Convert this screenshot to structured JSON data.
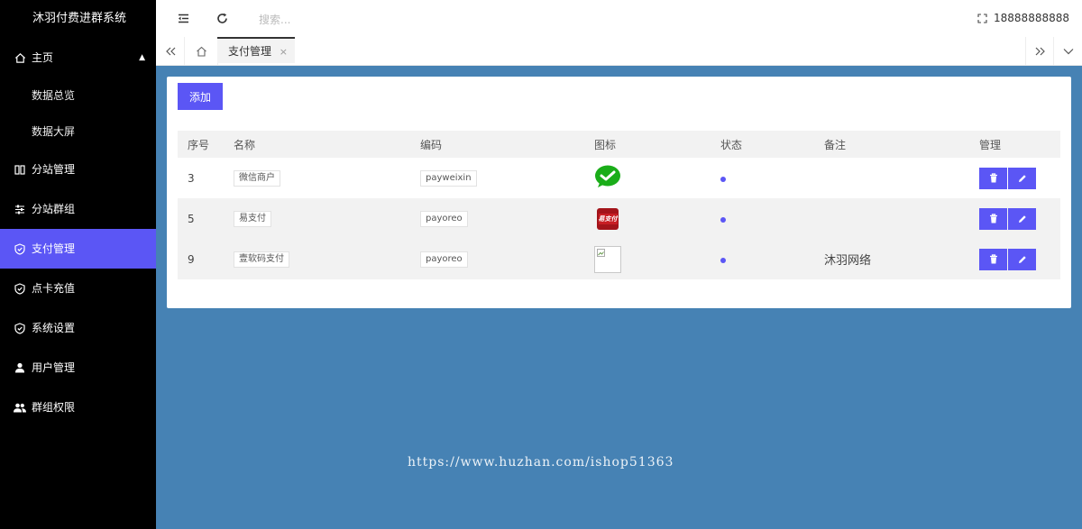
{
  "app": {
    "title": "沐羽付费进群系统"
  },
  "sidebar": {
    "home": {
      "label": "主页",
      "icon": "home-icon"
    },
    "home_children": [
      {
        "label": "数据总览"
      },
      {
        "label": "数据大屏"
      }
    ],
    "items": [
      {
        "label": "分站管理",
        "icon": "columns-icon"
      },
      {
        "label": "分站群组",
        "icon": "sliders-icon"
      },
      {
        "label": "支付管理",
        "icon": "shield-icon",
        "active": true
      },
      {
        "label": "点卡充值",
        "icon": "shield-icon"
      },
      {
        "label": "系统设置",
        "icon": "shield-icon"
      },
      {
        "label": "用户管理",
        "icon": "user-icon"
      },
      {
        "label": "群组权限",
        "icon": "users-icon"
      }
    ]
  },
  "topbar": {
    "search_placeholder": "搜索...",
    "user_name": "18888888888"
  },
  "tabs": {
    "active_label": "支付管理",
    "close_glyph": "×"
  },
  "toolbar": {
    "add_label": "添加"
  },
  "table": {
    "columns": [
      "序号",
      "名称",
      "编码",
      "图标",
      "状态",
      "备注",
      "管理"
    ],
    "rows": [
      {
        "id": "3",
        "name": "微信商户",
        "code": "payweixin",
        "icon": "wechat-pay-icon",
        "status": "enabled",
        "remark": ""
      },
      {
        "id": "5",
        "name": "易支付",
        "code": "payoreo",
        "icon": "yizhifu-icon",
        "status": "enabled",
        "remark": ""
      },
      {
        "id": "9",
        "name": "壹软码支付",
        "code": "payoreo",
        "icon": "broken-image-icon",
        "status": "enabled",
        "remark": "沐羽网络"
      }
    ]
  },
  "yizhifu_logo_text": "易支付",
  "watermark": "https://www.huzhan.com/ishop51363",
  "colors": {
    "accent": "#5b56f5",
    "background": "#4682b4",
    "sidebar": "#000000"
  }
}
